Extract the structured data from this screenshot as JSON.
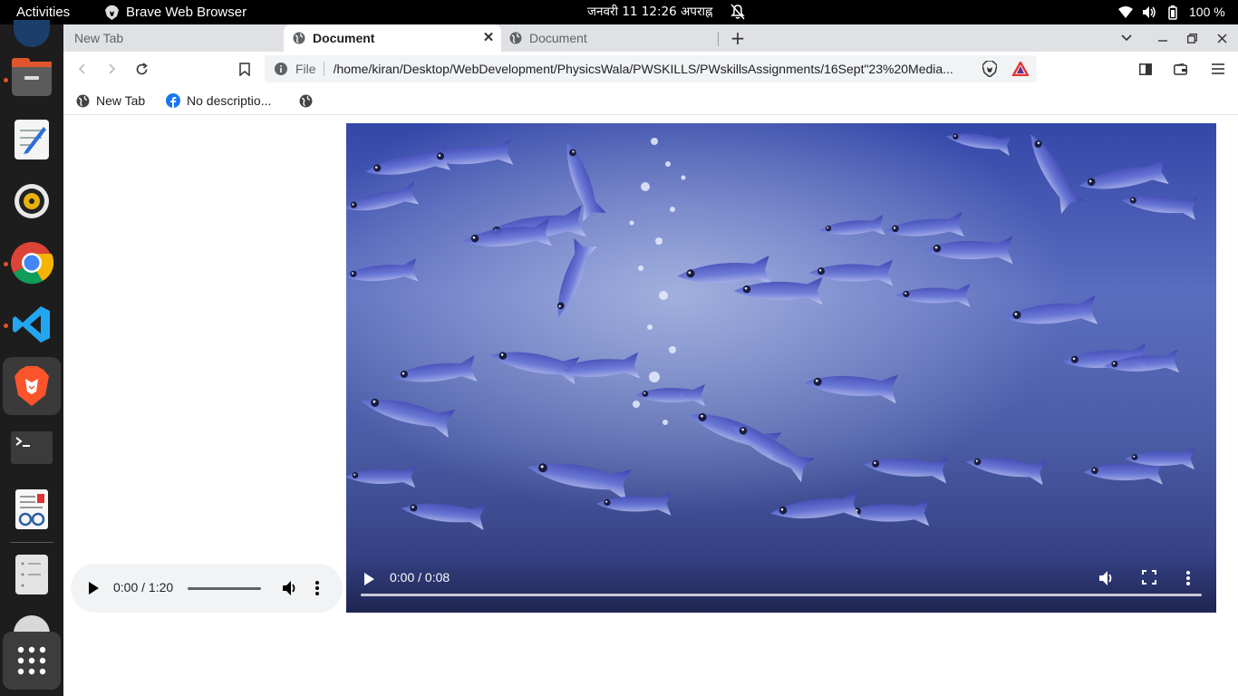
{
  "topbar": {
    "activities": "Activities",
    "app_name": "Brave Web Browser",
    "clock": "जनवरी 11  12:26 अपराह्न",
    "battery": "100 %"
  },
  "dock": {
    "items": [
      "files-icon",
      "text-editor-icon",
      "rhythmbox-icon",
      "chrome-icon",
      "vscode-icon",
      "brave-icon",
      "terminal-icon",
      "document-viewer-icon",
      "disks-icon",
      "app-grid-icon"
    ]
  },
  "tabs": [
    {
      "title": "New Tab",
      "active": false
    },
    {
      "title": "Document",
      "active": true
    },
    {
      "title": "Document",
      "active": false
    }
  ],
  "omnibox": {
    "scheme": "File",
    "url": "/home/kiran/Desktop/WebDevelopment/PhysicsWala/PWSKILLS/PWskillsAssignments/16Sept\"23%20Media..."
  },
  "bookmarks": [
    {
      "label": "New Tab",
      "icon": "globe-icon"
    },
    {
      "label": "No descriptio...",
      "icon": "facebook-icon"
    },
    {
      "label": "",
      "icon": "globe-icon"
    }
  ],
  "audio_player": {
    "time": "0:00 / 1:20",
    "progress": 0
  },
  "video_player": {
    "time": "0:00 / 0:08",
    "progress": 0
  },
  "colors": {
    "topbar_bg": "#000000",
    "dock_bg": "#1d1d1d",
    "tabstrip_bg": "#dfe1e5",
    "brave_orange": "#fb542b",
    "video_blue": "#3c4fae"
  }
}
